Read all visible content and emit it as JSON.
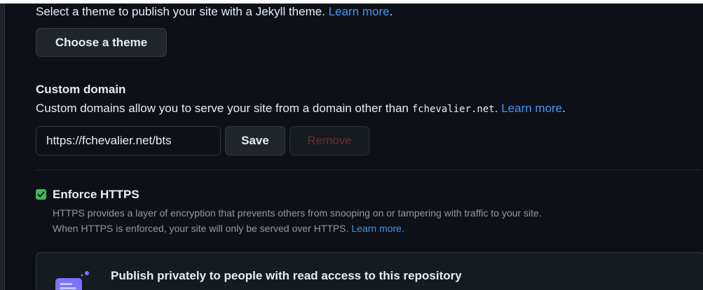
{
  "pages_theme": {
    "description": "Select a theme to publish your site with a Jekyll theme.",
    "learn_more": "Learn more",
    "choose_button": "Choose a theme"
  },
  "custom_domain": {
    "title": "Custom domain",
    "description_prefix": "Custom domains allow you to serve your site from a domain other than",
    "default_domain": "fchevalier.net",
    "description_suffix": ".",
    "learn_more": "Learn more",
    "input_value": "https://fchevalier.net/bts",
    "save_button": "Save",
    "remove_button": "Remove"
  },
  "enforce_https": {
    "checked": true,
    "title": "Enforce HTTPS",
    "line1": "HTTPS provides a layer of encryption that prevents others from snooping on or tampering with traffic to your site.",
    "line2": "When HTTPS is enforced, your site will only be served over HTTPS.",
    "learn_more": "Learn more",
    "trailing": "."
  },
  "private_publish": {
    "title": "Publish privately to people with read access to this repository"
  },
  "colors": {
    "background": "#0d1117",
    "link": "#4493f8",
    "checkbox": "#3fb950",
    "muted_text": "#9198a1",
    "icon_accent": "#7c72ff"
  }
}
